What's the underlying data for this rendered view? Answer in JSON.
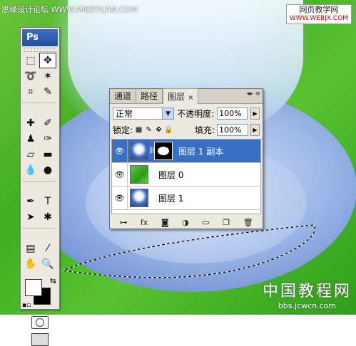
{
  "watermarks": {
    "top_left": "思缘设计论坛 WWW.MISSYUAN.COM",
    "top_right_cn": "网页教学网",
    "top_right_url": "WWW.WEBJX.COM",
    "bottom_right_cn": "中国教程网",
    "bottom_right_url": "bbs.jcwcn.com"
  },
  "tools_panel": {
    "logo": "Ps",
    "tools": [
      {
        "icon": "marquee-icon",
        "glyph": "⬚"
      },
      {
        "icon": "move-icon",
        "glyph": "✥",
        "active": true
      },
      {
        "icon": "lasso-icon",
        "glyph": "➰"
      },
      {
        "icon": "magic-wand-icon",
        "glyph": "✶"
      },
      {
        "icon": "crop-icon",
        "glyph": "⌗"
      },
      {
        "icon": "eyedropper-icon",
        "glyph": "✎"
      },
      {
        "icon": "healing-brush-icon",
        "glyph": "✚"
      },
      {
        "icon": "brush-icon",
        "glyph": "✐"
      },
      {
        "icon": "clone-stamp-icon",
        "glyph": "♟"
      },
      {
        "icon": "history-brush-icon",
        "glyph": "✑"
      },
      {
        "icon": "eraser-icon",
        "glyph": "▱"
      },
      {
        "icon": "gradient-icon",
        "glyph": "▬"
      },
      {
        "icon": "blur-icon",
        "glyph": "💧"
      },
      {
        "icon": "dodge-icon",
        "glyph": "●"
      },
      {
        "icon": "pen-icon",
        "glyph": "✒"
      },
      {
        "icon": "type-icon",
        "glyph": "T"
      },
      {
        "icon": "path-selection-icon",
        "glyph": "➤"
      },
      {
        "icon": "custom-shape-icon",
        "glyph": "✱"
      },
      {
        "icon": "notes-icon",
        "glyph": "▤"
      },
      {
        "icon": "eyedropper2-icon",
        "glyph": "⁄"
      },
      {
        "icon": "hand-icon",
        "glyph": "✋"
      },
      {
        "icon": "zoom-icon",
        "glyph": "🔍"
      }
    ],
    "foreground_color": "#ffffff",
    "background_color": "#000000"
  },
  "layers_panel": {
    "tabs": [
      {
        "label": "通道",
        "active": false
      },
      {
        "label": "路径",
        "active": false
      },
      {
        "label": "图层",
        "active": true
      }
    ],
    "tab_close": "×",
    "blend_mode": "正常",
    "opacity_label": "不透明度:",
    "opacity_value": "100%",
    "lock_label": "锁定:",
    "fill_label": "填充:",
    "fill_value": "100%",
    "layers": [
      {
        "name": "图层 1 副本",
        "thumb": "cup",
        "has_mask": true,
        "selected": true,
        "visible": true
      },
      {
        "name": "图层 0",
        "thumb": "grass",
        "has_mask": false,
        "selected": false,
        "visible": true
      },
      {
        "name": "图层 1",
        "thumb": "cup",
        "has_mask": false,
        "selected": false,
        "visible": true
      }
    ],
    "bottom_icons": [
      {
        "icon": "link-layers-icon",
        "glyph": "⊶"
      },
      {
        "icon": "layer-style-icon",
        "glyph": "fx"
      },
      {
        "icon": "add-mask-icon",
        "glyph": "◙"
      },
      {
        "icon": "adjustment-layer-icon",
        "glyph": "◑"
      },
      {
        "icon": "new-group-icon",
        "glyph": "▭"
      },
      {
        "icon": "new-layer-icon",
        "glyph": "❐"
      },
      {
        "icon": "delete-layer-icon",
        "glyph": "🗑"
      }
    ]
  }
}
